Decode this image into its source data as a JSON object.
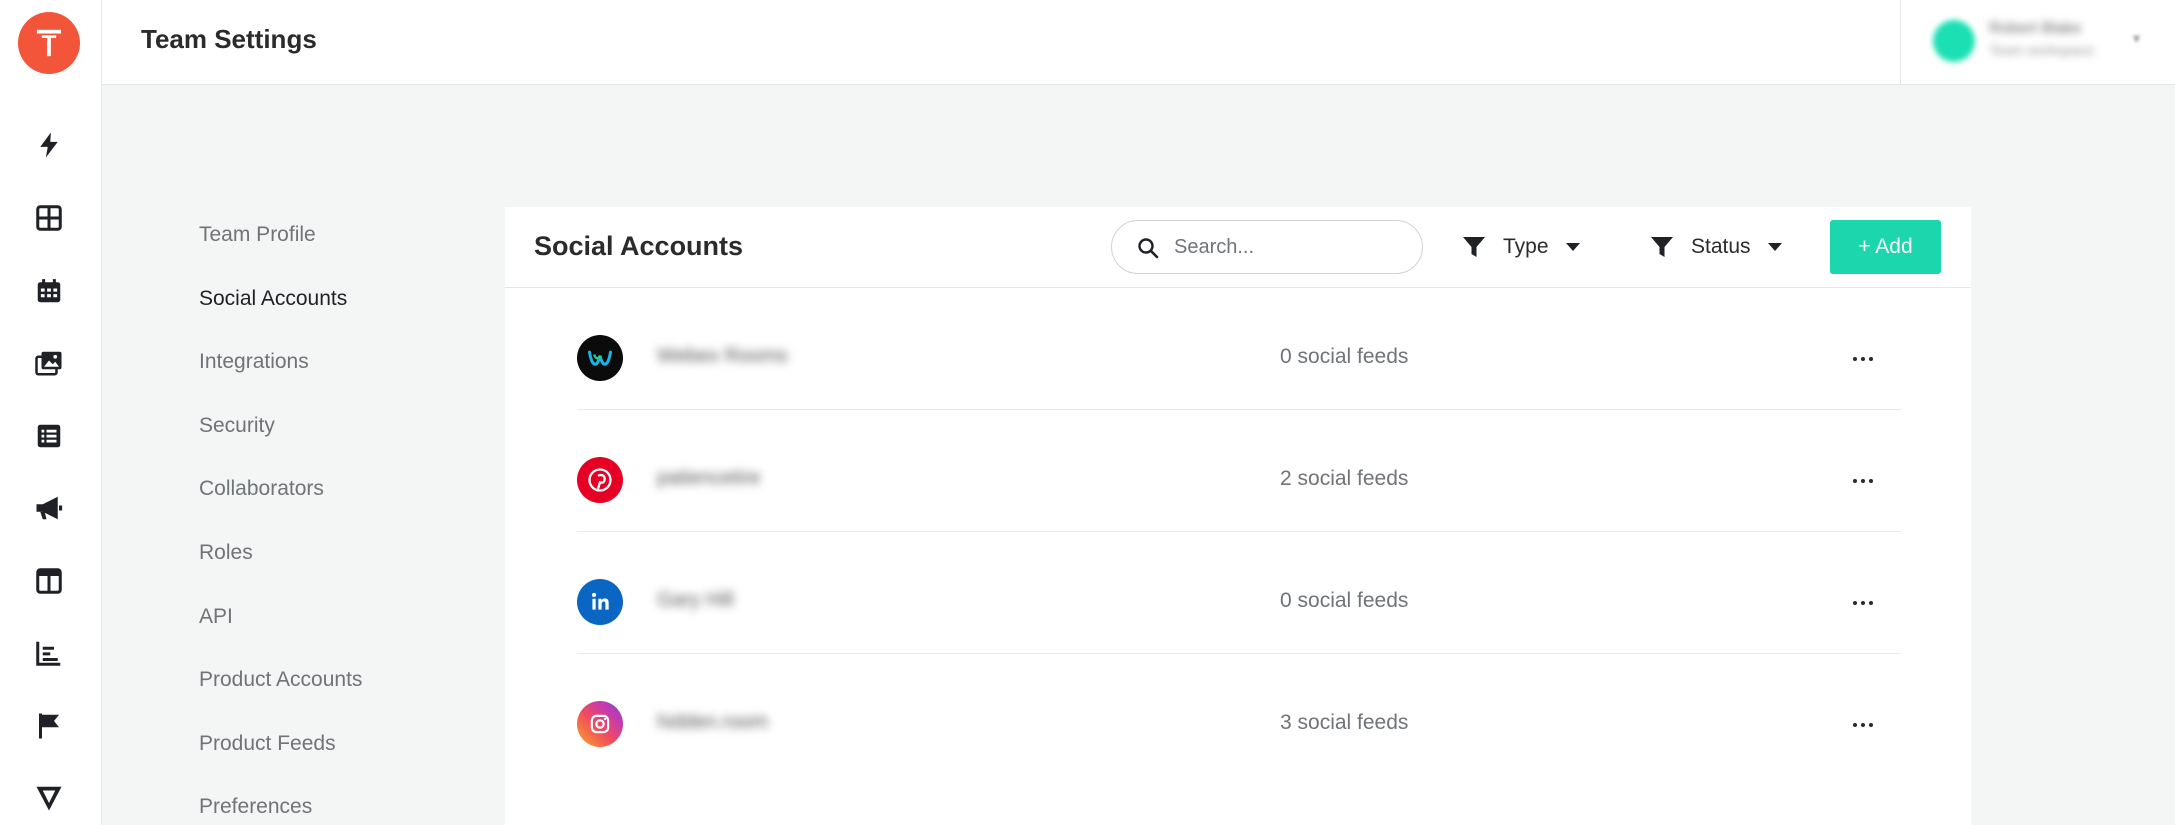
{
  "app": {
    "logo_letter": "T",
    "brand_color": "#f2553a",
    "accent_color": "#1cd6ad"
  },
  "header": {
    "title": "Team Settings",
    "user": {
      "name": "Robert Blake",
      "subtitle": "Team workspace"
    }
  },
  "rail": {
    "icons": [
      "lightning-icon",
      "grid-icon",
      "calendar-icon",
      "media-library-icon",
      "list-icon",
      "megaphone-icon",
      "layout-icon",
      "analytics-icon",
      "flag-icon",
      "brand-v-icon"
    ]
  },
  "settings_nav": {
    "items": [
      {
        "label": "Team Profile",
        "active": false
      },
      {
        "label": "Social Accounts",
        "active": true
      },
      {
        "label": "Integrations",
        "active": false
      },
      {
        "label": "Security",
        "active": false
      },
      {
        "label": "Collaborators",
        "active": false
      },
      {
        "label": "Roles",
        "active": false
      },
      {
        "label": "API",
        "active": false
      },
      {
        "label": "Product Accounts",
        "active": false
      },
      {
        "label": "Product Feeds",
        "active": false
      },
      {
        "label": "Preferences",
        "active": false
      }
    ]
  },
  "social_accounts": {
    "title": "Social Accounts",
    "search_placeholder": "Search...",
    "filter_type_label": "Type",
    "filter_status_label": "Status",
    "add_label": "+ Add",
    "accounts": [
      {
        "platform": "webex",
        "platform_icon": "webex-icon",
        "name": "Webex Rooms",
        "feeds": "0 social feeds"
      },
      {
        "platform": "pinterest",
        "platform_icon": "pinterest-icon",
        "name": "patiencetire",
        "feeds": "2 social feeds"
      },
      {
        "platform": "linkedin",
        "platform_icon": "linkedin-icon",
        "name": "Gary Hill",
        "feeds": "0 social feeds"
      },
      {
        "platform": "instagram",
        "platform_icon": "instagram-icon",
        "name": "hidden.room",
        "feeds": "3 social feeds"
      }
    ]
  }
}
